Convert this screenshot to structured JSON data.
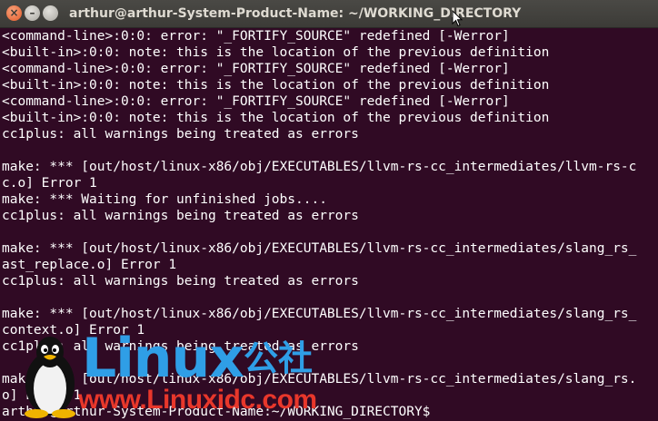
{
  "window": {
    "title": "arthur@arthur-System-Product-Name: ~/WORKING_DIRECTORY",
    "buttons": {
      "close": "×",
      "minimize": "–",
      "maximize": ""
    }
  },
  "terminal": {
    "lines": [
      "<command-line>:0:0: error: \"_FORTIFY_SOURCE\" redefined [-Werror]",
      "<built-in>:0:0: note: this is the location of the previous definition",
      "<command-line>:0:0: error: \"_FORTIFY_SOURCE\" redefined [-Werror]",
      "<built-in>:0:0: note: this is the location of the previous definition",
      "<command-line>:0:0: error: \"_FORTIFY_SOURCE\" redefined [-Werror]",
      "<built-in>:0:0: note: this is the location of the previous definition",
      "cc1plus: all warnings being treated as errors",
      "",
      "make: *** [out/host/linux-x86/obj/EXECUTABLES/llvm-rs-cc_intermediates/llvm-rs-c",
      "c.o] Error 1",
      "make: *** Waiting for unfinished jobs....",
      "cc1plus: all warnings being treated as errors",
      "",
      "make: *** [out/host/linux-x86/obj/EXECUTABLES/llvm-rs-cc_intermediates/slang_rs_",
      "ast_replace.o] Error 1",
      "cc1plus: all warnings being treated as errors",
      "",
      "make: *** [out/host/linux-x86/obj/EXECUTABLES/llvm-rs-cc_intermediates/slang_rs_",
      "context.o] Error 1",
      "cc1plus: all warnings being treated as errors",
      "",
      "make: *** [out/host/linux-x86/obj/EXECUTABLES/llvm-rs-cc_intermediates/slang_rs.",
      "o] Error 1",
      "arthur@arthur-System-Product-Name:~/WORKING_DIRECTORY$"
    ]
  },
  "watermark": {
    "brand": "Linux",
    "brand_cn": "公社",
    "url": "www.Linuxidc.com"
  },
  "colors": {
    "terminal_bg": "#300a24",
    "terminal_fg": "#ffffff",
    "brand_blue": "#2f9ee6",
    "brand_red": "#e8372b"
  }
}
